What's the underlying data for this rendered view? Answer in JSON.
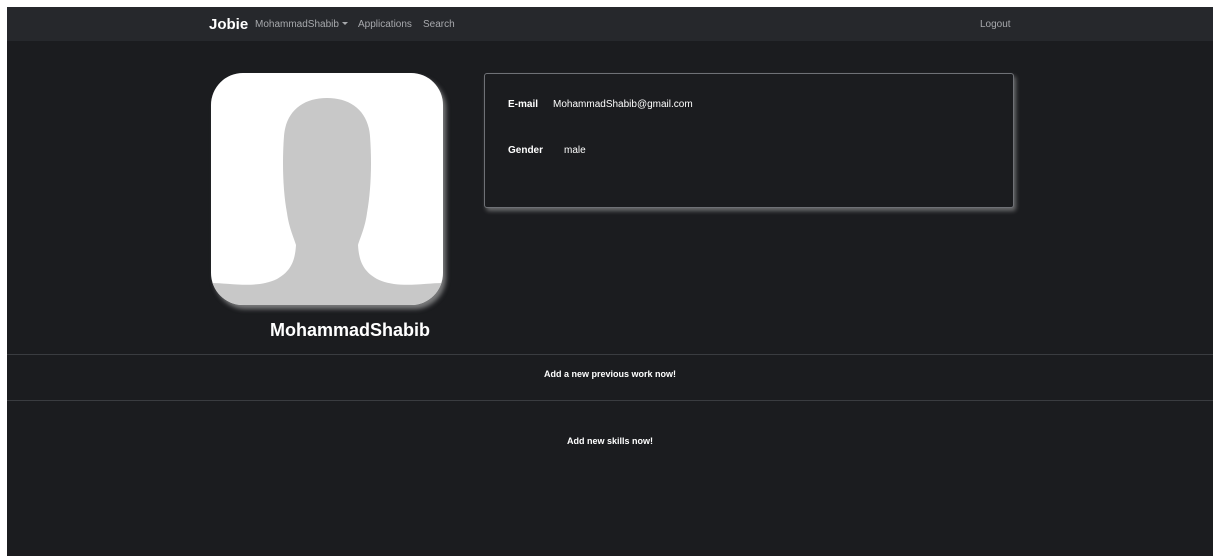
{
  "navbar": {
    "brand": "Jobie",
    "user_menu": "MohammadShabib",
    "applications": "Applications",
    "search": "Search",
    "logout": "Logout"
  },
  "profile": {
    "username": "MohammadShabib",
    "avatar_icon": "person-silhouette-icon"
  },
  "info": {
    "email_label": "E-mail",
    "email_value": "MohammadShabib@gmail.com",
    "gender_label": "Gender",
    "gender_value": "male"
  },
  "sections": {
    "previous_work": "Add a new previous work now!",
    "skills": "Add new skills now!"
  },
  "colors": {
    "background": "#1b1c1f",
    "navbar": "#26282c",
    "nav_link": "#a7a9ad",
    "silhouette": "#c8c8c8"
  }
}
